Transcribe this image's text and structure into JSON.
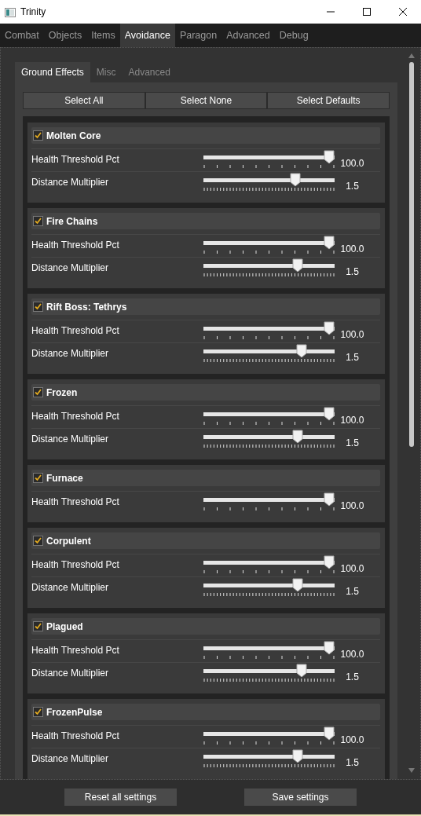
{
  "window": {
    "title": "Trinity"
  },
  "tabs": [
    {
      "label": "Combat",
      "selected": false
    },
    {
      "label": "Objects",
      "selected": false
    },
    {
      "label": "Items",
      "selected": false
    },
    {
      "label": "Avoidance",
      "selected": true
    },
    {
      "label": "Paragon",
      "selected": false
    },
    {
      "label": "Advanced",
      "selected": false
    },
    {
      "label": "Debug",
      "selected": false
    }
  ],
  "subtabs": [
    {
      "label": "Ground Effects",
      "selected": true
    },
    {
      "label": "Misc",
      "selected": false
    },
    {
      "label": "Advanced",
      "selected": false
    }
  ],
  "buttons": [
    "Select All",
    "Select None",
    "Select Defaults"
  ],
  "groups": [
    {
      "name": "Molten Core",
      "checked": true,
      "settings": [
        {
          "label": "Health Threshold Pct",
          "kind": "coarse",
          "level": 1.0,
          "reading": "100.0"
        },
        {
          "label": "Distance Multiplier",
          "kind": "fine",
          "level": 0.72,
          "reading": "1.5"
        }
      ]
    },
    {
      "name": "Fire Chains",
      "checked": true,
      "settings": [
        {
          "label": "Health Threshold Pct",
          "kind": "coarse",
          "level": 1.0,
          "reading": "100.0"
        },
        {
          "label": "Distance Multiplier",
          "kind": "fine",
          "level": 0.74,
          "reading": "1.5"
        }
      ]
    },
    {
      "name": "Rift Boss: Tethrys",
      "checked": true,
      "settings": [
        {
          "label": "Health Threshold Pct",
          "kind": "coarse",
          "level": 1.0,
          "reading": "100.0"
        },
        {
          "label": "Distance Multiplier",
          "kind": "fine",
          "level": 0.77,
          "reading": "1.5"
        }
      ]
    },
    {
      "name": "Frozen",
      "checked": true,
      "settings": [
        {
          "label": "Health Threshold Pct",
          "kind": "coarse",
          "level": 1.0,
          "reading": "100.0"
        },
        {
          "label": "Distance Multiplier",
          "kind": "fine",
          "level": 0.74,
          "reading": "1.5"
        }
      ]
    },
    {
      "name": "Furnace",
      "checked": true,
      "settings": [
        {
          "label": "Health Threshold Pct",
          "kind": "coarse",
          "level": 1.0,
          "reading": "100.0"
        }
      ]
    },
    {
      "name": "Corpulent",
      "checked": true,
      "settings": [
        {
          "label": "Health Threshold Pct",
          "kind": "coarse",
          "level": 1.0,
          "reading": "100.0"
        },
        {
          "label": "Distance Multiplier",
          "kind": "fine",
          "level": 0.74,
          "reading": "1.5"
        }
      ]
    },
    {
      "name": "Plagued",
      "checked": true,
      "settings": [
        {
          "label": "Health Threshold Pct",
          "kind": "coarse",
          "level": 1.0,
          "reading": "100.0"
        },
        {
          "label": "Distance Multiplier",
          "kind": "fine",
          "level": 0.77,
          "reading": "1.5"
        }
      ]
    },
    {
      "name": "FrozenPulse",
      "checked": true,
      "settings": [
        {
          "label": "Health Threshold Pct",
          "kind": "coarse",
          "level": 1.0,
          "reading": "100.0"
        },
        {
          "label": "Distance Multiplier",
          "kind": "fine",
          "level": 0.74,
          "reading": "1.5"
        }
      ]
    }
  ],
  "footer": [
    "Reset all settings",
    "Save settings"
  ]
}
